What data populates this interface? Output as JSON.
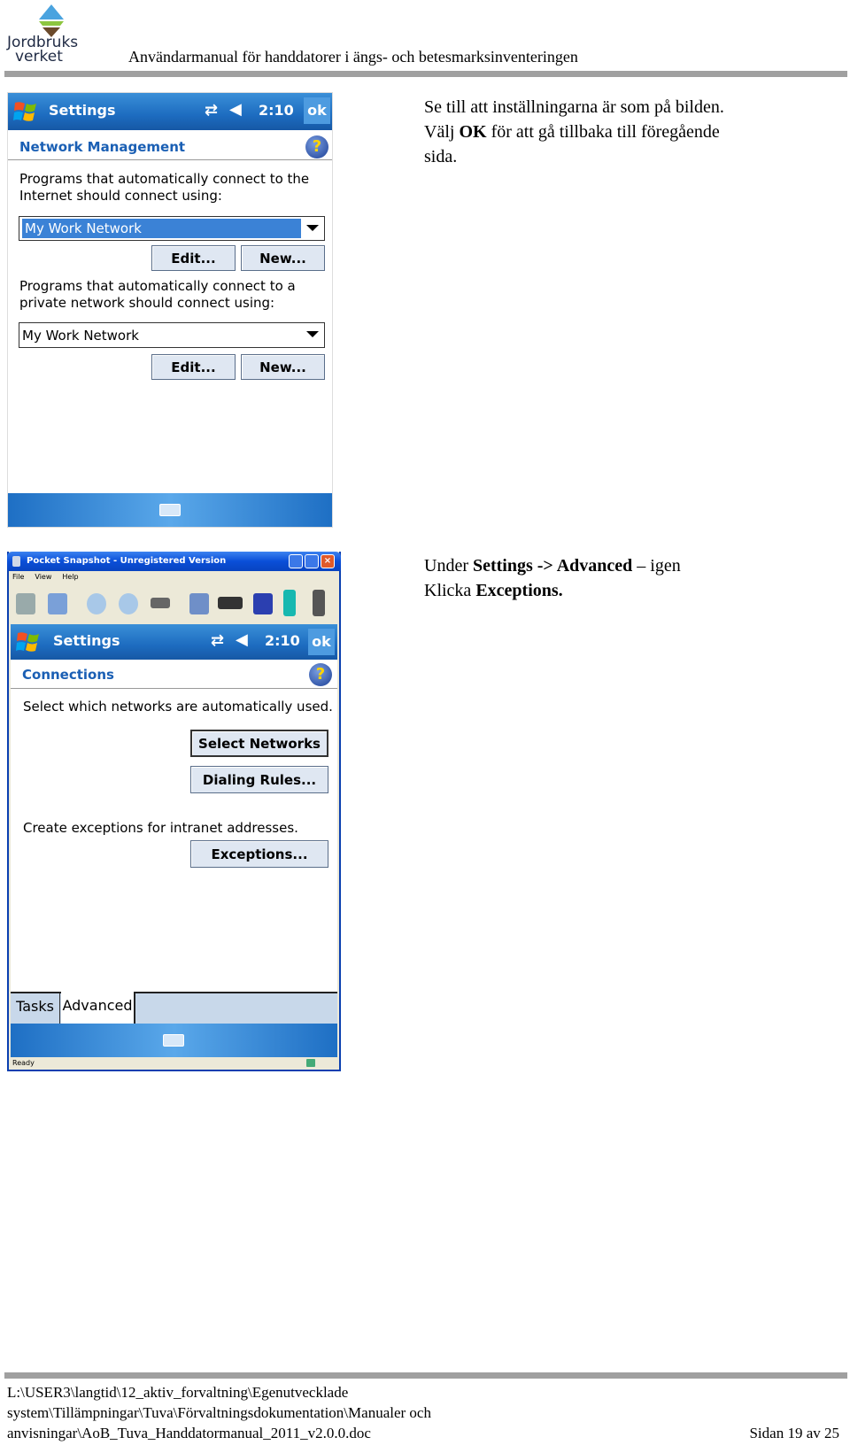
{
  "header": {
    "logo_text": [
      "Jordbruks",
      "verket"
    ],
    "title": "Användarmanual för handdatorer i ängs- och betesmarksinventeringen"
  },
  "instruction1": {
    "line1": "Se till att inställningarna är som på bilden.",
    "line2_pre": "Välj ",
    "line2_bold": "OK",
    "line2_post": " för att gå tillbaka till föregående",
    "line3": "sida."
  },
  "instruction2": {
    "pre": "Under ",
    "bold1": "Settings -> Advanced",
    "mid": " – igen",
    "line2_pre": "Klicka ",
    "bold2": "Exceptions."
  },
  "screen1": {
    "app_title": "Settings",
    "time": "2:10",
    "ok": "ok",
    "section": "Network Management",
    "text1a": "Programs that automatically connect to the",
    "text1b": "Internet should connect using:",
    "dropdown1": "My Work Network",
    "edit": "Edit...",
    "new": "New...",
    "text2a": "Programs that automatically connect to a",
    "text2b": "private network should connect using:",
    "dropdown2": "My Work Network"
  },
  "screen2": {
    "window_title": "Pocket Snapshot - Unregistered Version",
    "menu": [
      "File",
      "View",
      "Help"
    ],
    "app_title": "Settings",
    "time": "2:10",
    "ok": "ok",
    "section": "Connections",
    "text1": "Select which networks are automatically used.",
    "select_networks": "Select Networks",
    "dialing_rules": "Dialing Rules...",
    "text2": "Create exceptions for intranet addresses.",
    "exceptions": "Exceptions...",
    "tabs": [
      "Tasks",
      "Advanced"
    ],
    "status": "Ready"
  },
  "footer": {
    "line1": "L:\\USER3\\langtid\\12_aktiv_forvaltning\\Egenutvecklade",
    "line2": "system\\Tillämpningar\\Tuva\\Förvaltningsdokumentation\\Manualer och",
    "line3": "anvisningar\\AoB_Tuva_Handdatormanual_2011_v2.0.0.doc",
    "page": "Sidan 19 av 25"
  },
  "colors": {
    "accent": "#1a5fb4",
    "titlebar": "#1d6cc0"
  }
}
